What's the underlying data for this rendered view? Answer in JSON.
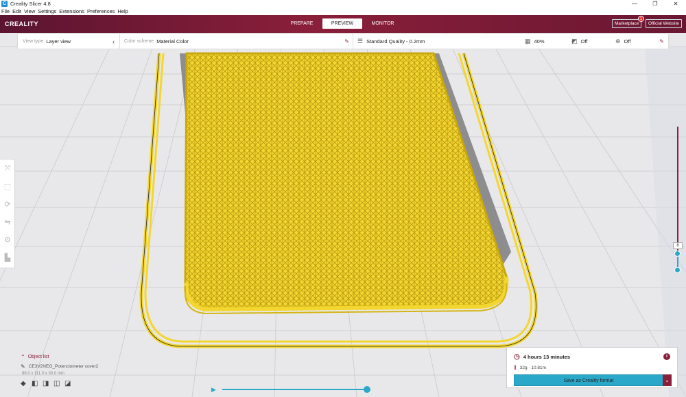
{
  "window": {
    "title": "Creality Slicer 4.8",
    "app_icon": "C",
    "minimize": "—",
    "maximize": "❐",
    "close": "✕"
  },
  "menu": [
    "File",
    "Edit",
    "View",
    "Settings",
    "Extensions",
    "Preferences",
    "Help"
  ],
  "header": {
    "logo": "CREALITY",
    "tabs": [
      "PREPARE",
      "PREVIEW",
      "MONITOR"
    ],
    "active_tab": "PREVIEW",
    "marketplace": "Marketplace",
    "marketplace_badge": "1",
    "official_website": "Official Website"
  },
  "settings_bar": {
    "view_type_label": "View type",
    "view_type_value": "Layer view",
    "color_scheme_label": "Color scheme",
    "color_scheme_value": "Material Color",
    "profile": "Standard Quality - 0.2mm",
    "infill": "40%",
    "support": "Off",
    "adhesion": "Off"
  },
  "layer_slider": {
    "current_layer": "8"
  },
  "object_list": {
    "title": "Object list",
    "object_name": "CE3V2NEO_Potenciometer cover2",
    "dimensions": "86.0 x 111.0 x 30.0 mm"
  },
  "print_info": {
    "time": "4 hours 13 minutes",
    "material": "32g · 10.81m",
    "save_button": "Save as Creality format"
  },
  "colors": {
    "accent": "#8a1f3a",
    "teal": "#2aa8c9",
    "model_yellow": "#f3d630"
  },
  "icons": {
    "tools": [
      "move-tool-icon",
      "scale-tool-icon",
      "rotate-tool-icon",
      "mirror-tool-icon",
      "per-model-settings-icon",
      "support-blocker-icon"
    ]
  }
}
